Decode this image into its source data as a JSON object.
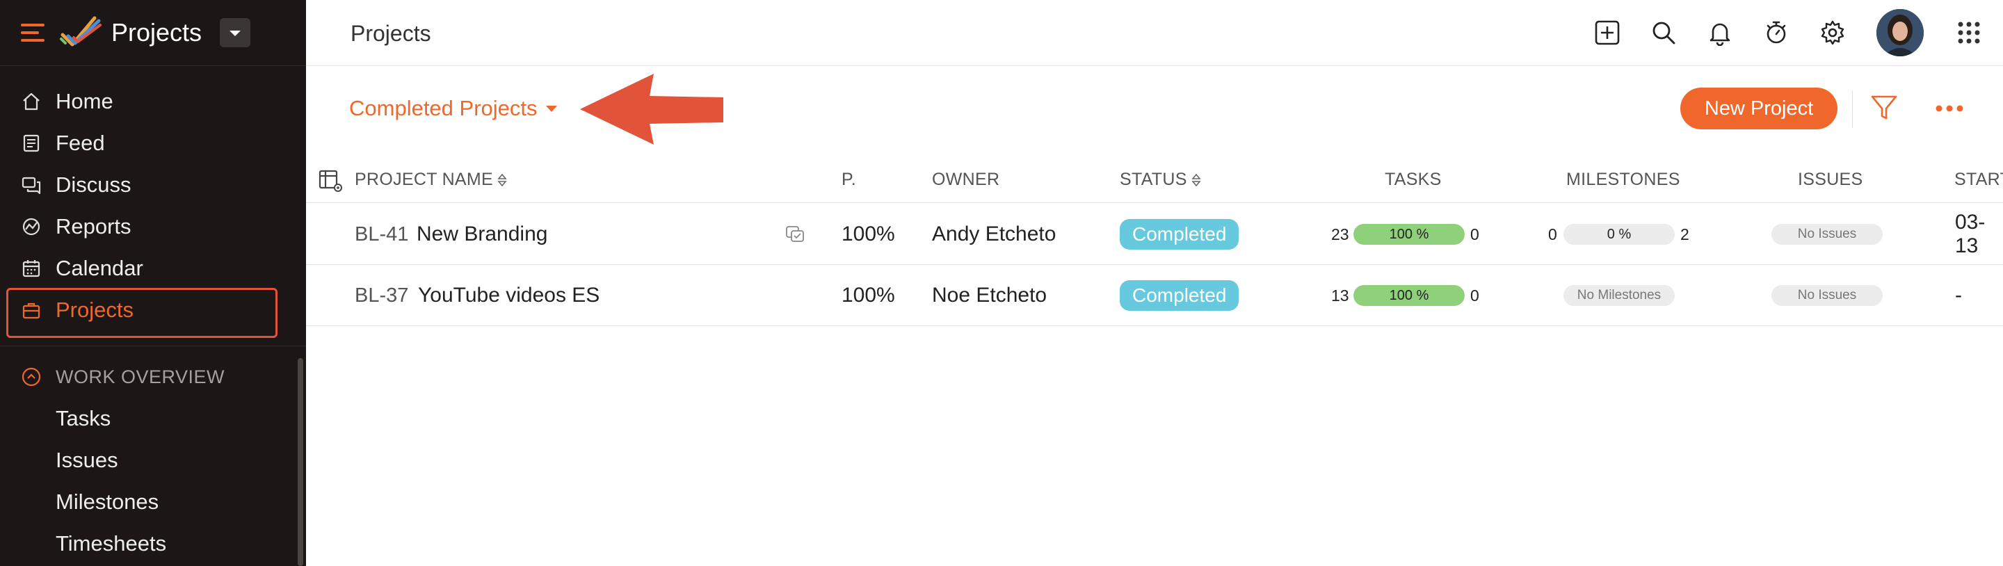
{
  "app": {
    "title": "Projects"
  },
  "sidebar": {
    "items": [
      {
        "label": "Home",
        "icon": "home-icon"
      },
      {
        "label": "Feed",
        "icon": "feed-icon"
      },
      {
        "label": "Discuss",
        "icon": "discuss-icon"
      },
      {
        "label": "Reports",
        "icon": "reports-icon"
      },
      {
        "label": "Calendar",
        "icon": "calendar-icon"
      },
      {
        "label": "Projects",
        "icon": "briefcase-icon",
        "active": true
      }
    ],
    "section": {
      "title": "WORK OVERVIEW",
      "items": [
        "Tasks",
        "Issues",
        "Milestones",
        "Timesheets"
      ]
    }
  },
  "header": {
    "title": "Projects"
  },
  "toolbar": {
    "view": "Completed Projects",
    "new_project": "New Project"
  },
  "table": {
    "columns": {
      "name": "PROJECT NAME",
      "percent": "P.",
      "owner": "OWNER",
      "status": "STATUS",
      "tasks": "TASKS",
      "milestones": "MILESTONES",
      "issues": "ISSUES",
      "start": "START"
    },
    "rows": [
      {
        "id": "BL-41",
        "name": "New Branding",
        "percent": "100%",
        "owner": "Andy Etcheto",
        "status": "Completed",
        "tasks_open": "23",
        "tasks_pct": "100 %",
        "tasks_closed": "0",
        "tasks_fill": 1.0,
        "ms_open": "0",
        "ms_pct": "0 %",
        "ms_closed": "2",
        "ms_fill": 0.0,
        "issues": "No Issues",
        "start": "03-13"
      },
      {
        "id": "BL-37",
        "name": "YouTube videos ES",
        "percent": "100%",
        "owner": "Noe Etcheto",
        "status": "Completed",
        "tasks_open": "13",
        "tasks_pct": "100 %",
        "tasks_closed": "0",
        "tasks_fill": 1.0,
        "milestones": "No Milestones",
        "issues": "No Issues",
        "start": "-"
      }
    ]
  },
  "colors": {
    "accent": "#f0672b",
    "sidebar_bg": "#1c1716",
    "status_completed": "#66c9dd",
    "progress": "#8fd07a",
    "annotation": "#e2543a"
  }
}
